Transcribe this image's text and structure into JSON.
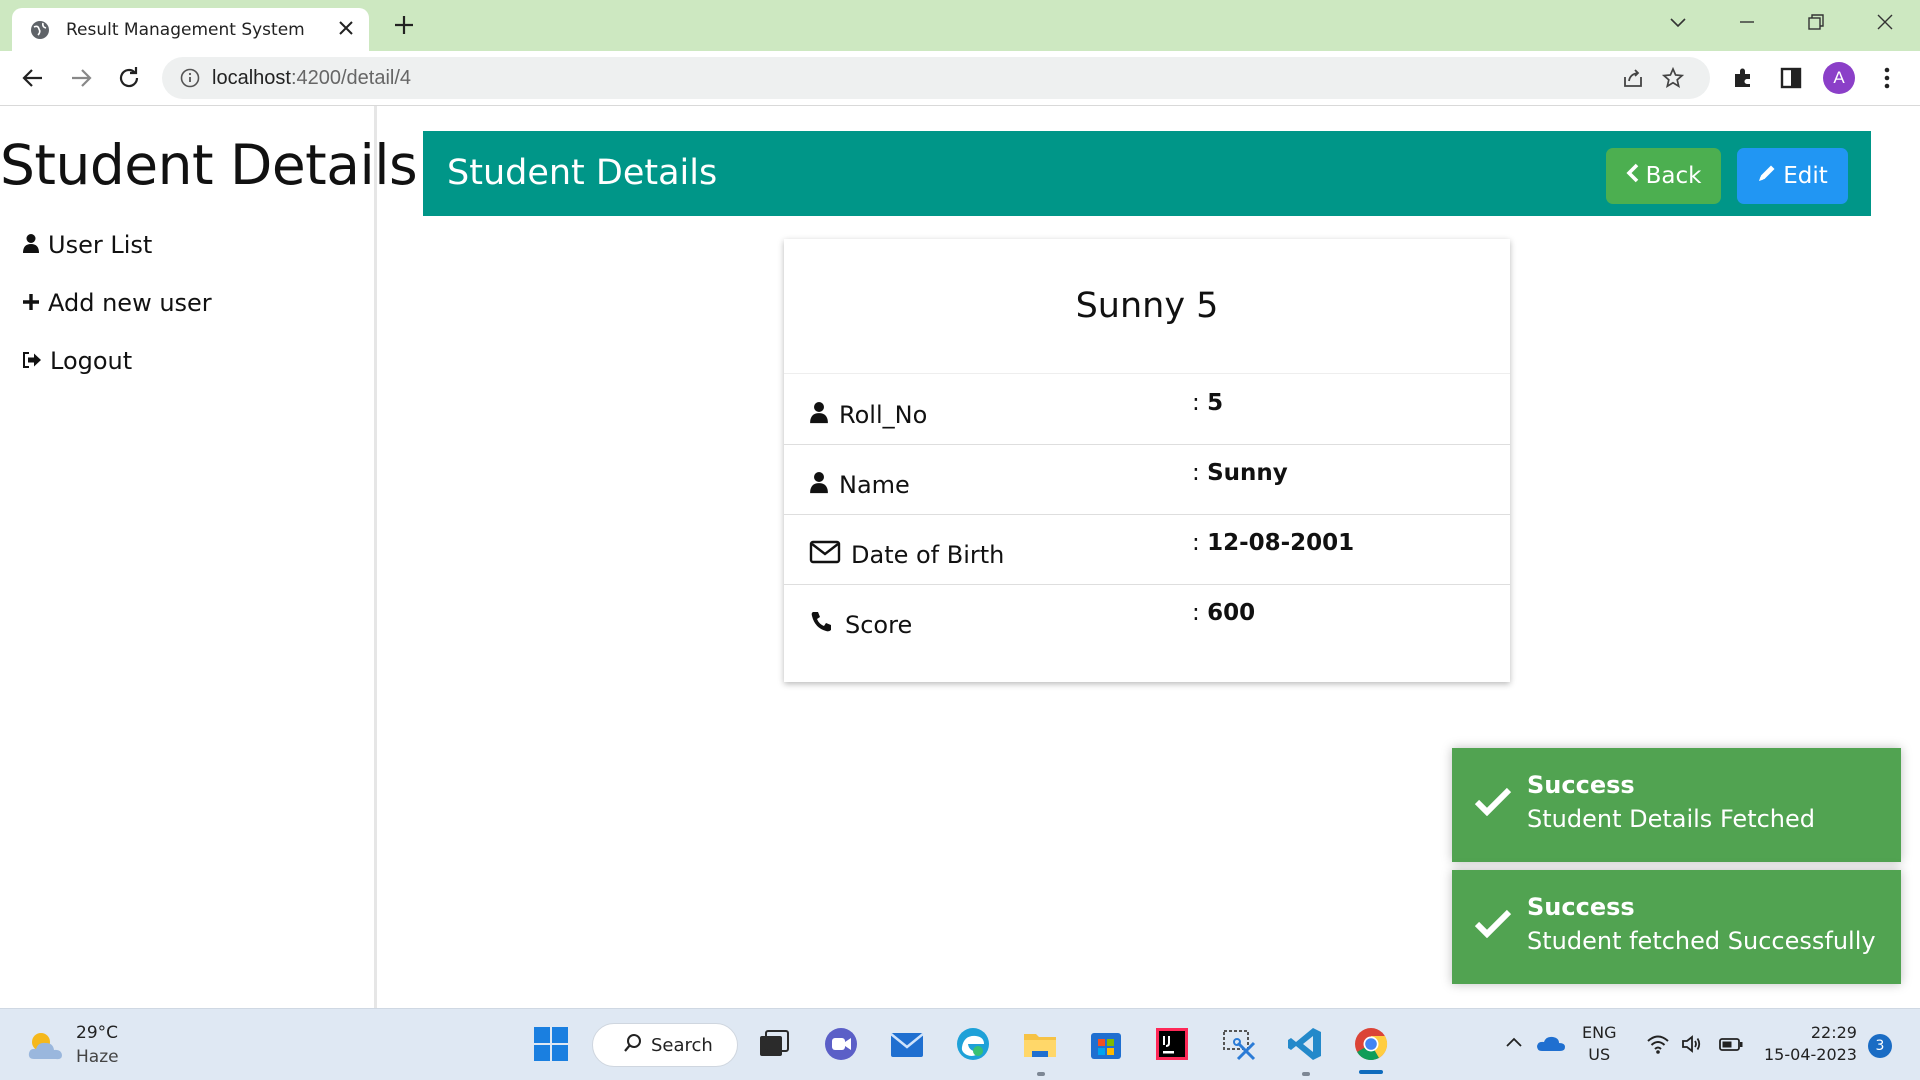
{
  "browser": {
    "tab_title": "Result Management System",
    "url_host": "localhost",
    "url_rest": ":4200/detail/4",
    "avatar_letter": "A"
  },
  "sidebar": {
    "brand": "Student Details",
    "items": [
      {
        "label": "User List",
        "icon": "user-icon"
      },
      {
        "label": "Add new user",
        "icon": "plus-icon"
      },
      {
        "label": "Logout",
        "icon": "sign-out-icon"
      }
    ]
  },
  "header": {
    "title": "Student Details",
    "back_label": "Back",
    "edit_label": "Edit",
    "bar_color": "#009688",
    "back_color": "#4caf50",
    "edit_color": "#2196f3"
  },
  "card": {
    "title": "Sunny 5",
    "rows": [
      {
        "label": "Roll_No",
        "value": "5",
        "icon": "user-icon"
      },
      {
        "label": "Name",
        "value": "Sunny",
        "icon": "user-icon"
      },
      {
        "label": "Date of Birth",
        "value": "12-08-2001",
        "icon": "envelope-icon"
      },
      {
        "label": "Score",
        "value": "600",
        "icon": "phone-icon"
      }
    ],
    "separator": ": "
  },
  "toasts": [
    {
      "title": "Success",
      "message": "Student Details Fetched"
    },
    {
      "title": "Success",
      "message": "Student fetched Successfully"
    }
  ],
  "toast_color": "#51a351",
  "taskbar": {
    "weather_temp": "29°C",
    "weather_cond": "Haze",
    "search_label": "Search",
    "lang_top": "ENG",
    "lang_bottom": "US",
    "time": "22:29",
    "date": "15-04-2023",
    "notification_count": "3"
  }
}
